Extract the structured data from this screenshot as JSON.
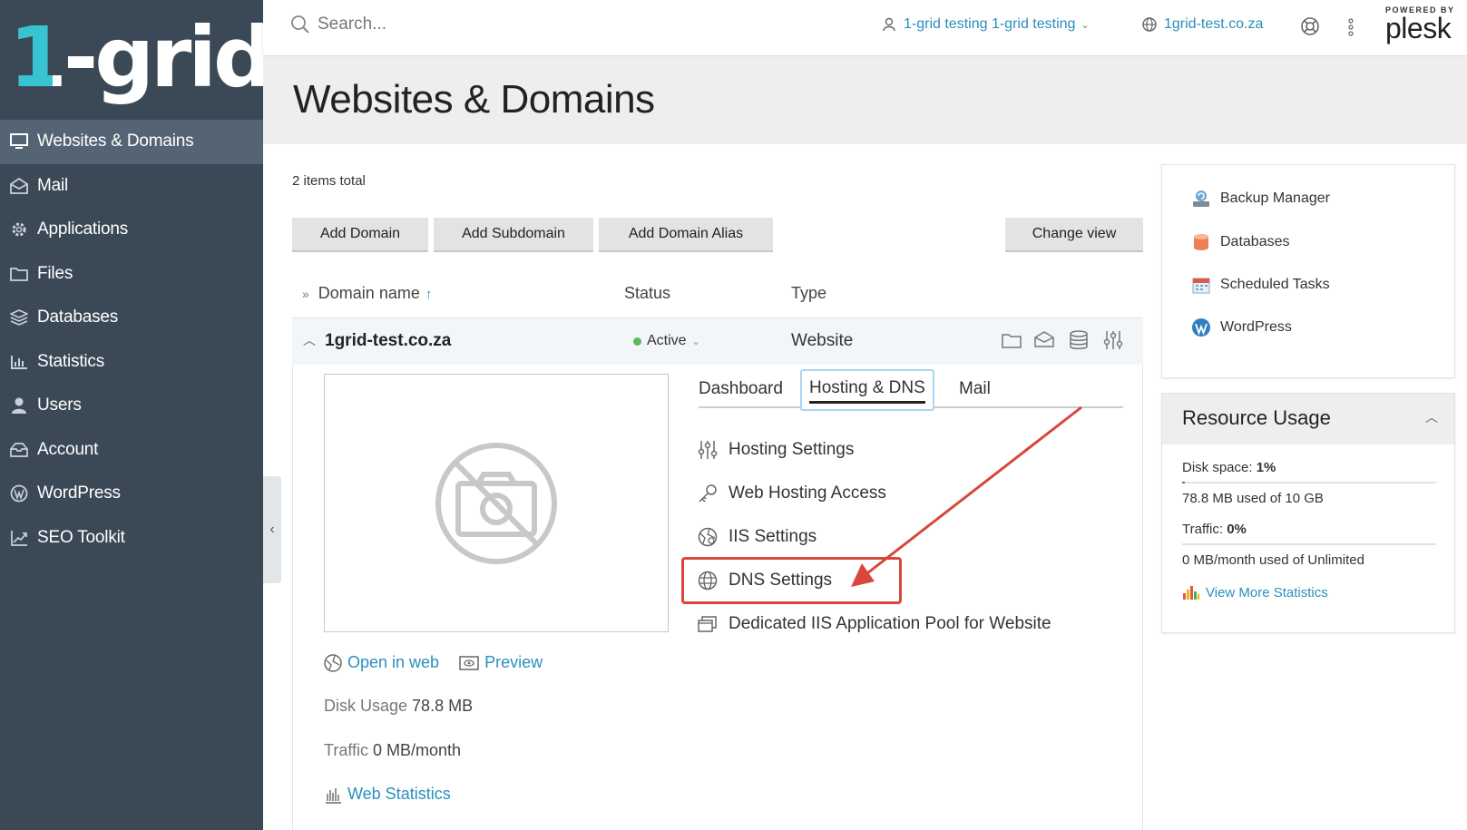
{
  "brand": {
    "logo_text": "1-grid",
    "powered_by": "POWERED BY",
    "plesk": "plesk"
  },
  "sidebar": {
    "items": [
      {
        "label": "Websites & Domains",
        "icon": "monitor-icon",
        "active": true
      },
      {
        "label": "Mail",
        "icon": "mail-icon"
      },
      {
        "label": "Applications",
        "icon": "gear-icon"
      },
      {
        "label": "Files",
        "icon": "folder-icon"
      },
      {
        "label": "Databases",
        "icon": "layers-icon"
      },
      {
        "label": "Statistics",
        "icon": "bar-chart-icon"
      },
      {
        "label": "Users",
        "icon": "user-icon"
      },
      {
        "label": "Account",
        "icon": "account-icon"
      },
      {
        "label": "WordPress",
        "icon": "wordpress-icon"
      },
      {
        "label": "SEO Toolkit",
        "icon": "seo-chart-icon"
      }
    ]
  },
  "header": {
    "search_placeholder": "Search...",
    "user": "1-grid testing 1-grid testing",
    "domain": "1grid-test.co.za"
  },
  "page": {
    "title": "Websites & Domains",
    "items_total": "2 items total"
  },
  "toolbar": {
    "add_domain": "Add Domain",
    "add_subdomain": "Add Subdomain",
    "add_alias": "Add Domain Alias",
    "change_view": "Change view"
  },
  "table": {
    "col_domain": "Domain name",
    "col_status": "Status",
    "col_type": "Type",
    "row": {
      "domain": "1grid-test.co.za",
      "status": "Active",
      "type": "Website"
    }
  },
  "detail": {
    "open_in_web": "Open in web",
    "preview": "Preview",
    "disk_label": "Disk Usage",
    "disk_value": "78.8 MB",
    "traffic_label": "Traffic",
    "traffic_value": "0 MB/month",
    "web_stats": "Web Statistics",
    "tabs": [
      "Dashboard",
      "Hosting & DNS",
      "Mail"
    ],
    "active_tab": "Hosting & DNS",
    "tools": [
      "Hosting Settings",
      "Web Hosting Access",
      "IIS Settings",
      "DNS Settings",
      "Dedicated IIS Application Pool for Website"
    ]
  },
  "right_panel": {
    "items": [
      "Backup Manager",
      "Databases",
      "Scheduled Tasks",
      "WordPress"
    ],
    "usage": {
      "title": "Resource Usage",
      "disk_label": "Disk space:",
      "disk_pct": "1%",
      "disk_detail": "78.8 MB used of 10 GB",
      "traffic_label": "Traffic:",
      "traffic_pct": "0%",
      "traffic_detail": "0 MB/month used of Unlimited",
      "view_more": "View More Statistics"
    }
  },
  "colors": {
    "accent": "#2a8fbd",
    "sidebar": "#3b4957",
    "highlight": "#d9463a",
    "active_status": "#5cb85c"
  }
}
